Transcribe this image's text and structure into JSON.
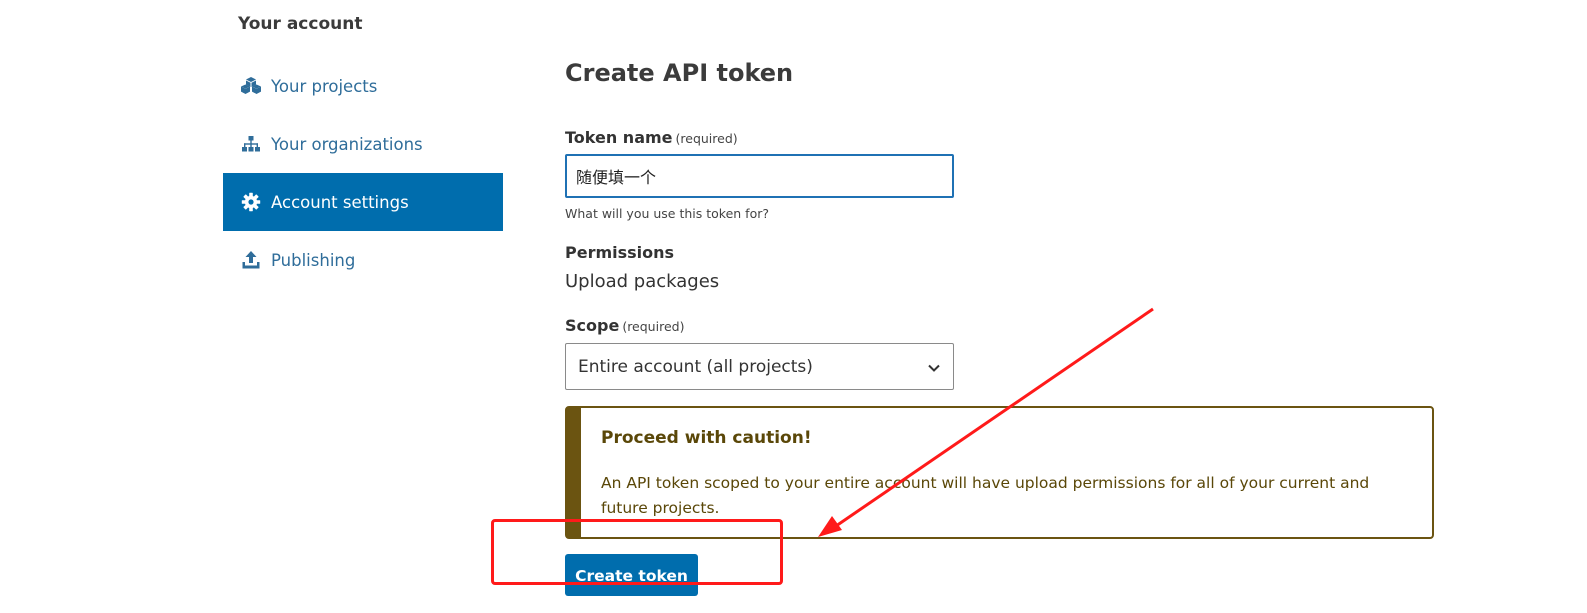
{
  "sidebar": {
    "heading": "Your account",
    "items": [
      {
        "label": "Your projects",
        "icon": "cubes-icon",
        "active": false
      },
      {
        "label": "Your organizations",
        "icon": "sitemap-icon",
        "active": false
      },
      {
        "label": "Account settings",
        "icon": "gear-icon",
        "active": true
      },
      {
        "label": "Publishing",
        "icon": "upload-icon",
        "active": false
      }
    ]
  },
  "form": {
    "title": "Create API token",
    "token_name": {
      "label": "Token name",
      "required": "(required)",
      "value": "随便填一个",
      "help": "What will you use this token for?"
    },
    "permissions": {
      "label": "Permissions",
      "value": "Upload packages"
    },
    "scope": {
      "label": "Scope",
      "required": "(required)",
      "selected": "Entire account (all projects)"
    },
    "caution": {
      "title": "Proceed with caution!",
      "body": "An API token scoped to your entire account will have upload permissions for all of your current and future projects."
    },
    "submit_label": "Create token"
  },
  "colors": {
    "primary": "#006dad",
    "link": "#2f6d9a",
    "caution": "#6b5411",
    "annotation": "#ff1a1a"
  }
}
